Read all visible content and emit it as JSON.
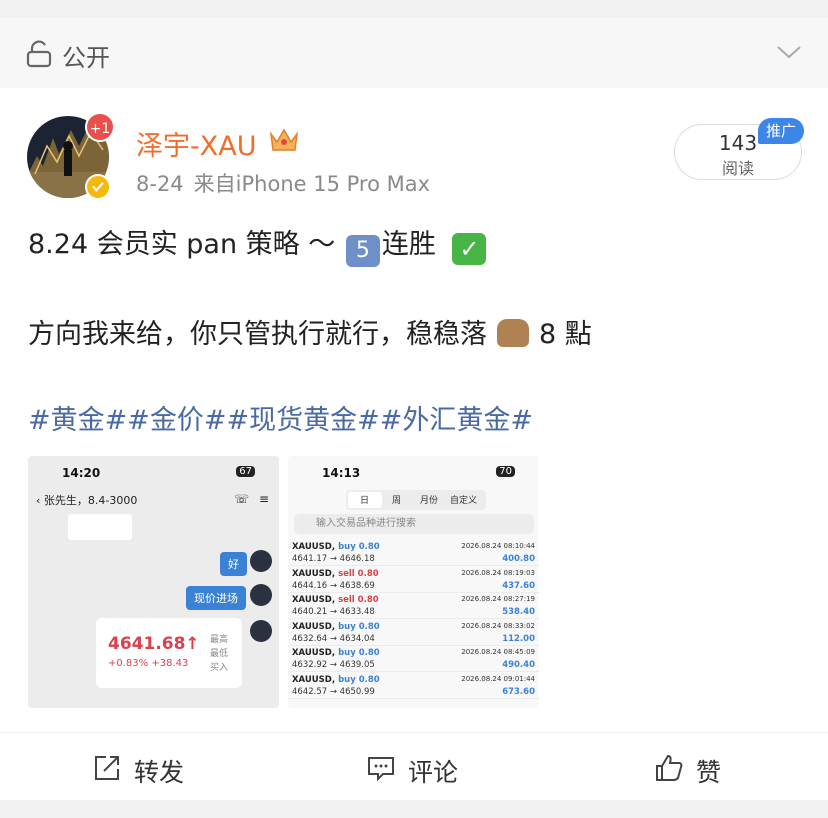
{
  "visibility": {
    "label": "公开"
  },
  "post": {
    "author": "泽宇-XAU",
    "notification_badge": "+1",
    "date": "8-24",
    "source": "来自iPhone 15 Pro Max",
    "reads": {
      "count": "143",
      "label": "阅读"
    },
    "promo_tag": "推广",
    "line1_text": "8.24 会员实 pan 策略 ～",
    "line1_emoji_number": "5",
    "line1_after": "连胜",
    "line2_text": "方向我来给，你只管执行就行，稳稳落",
    "line2_after": "8 點",
    "hashtags": "#黄金##金价##现货黄金##外汇黄金#"
  },
  "thumb_left": {
    "time": "14:20",
    "battery": "67",
    "chat_title": "张先生，8.4-3000",
    "messages": [
      "好",
      "现价进场"
    ],
    "quote": {
      "price": "4641.68↑",
      "change": "+0.83%  +38.43",
      "labels": [
        "最高",
        "最低",
        "买入"
      ]
    }
  },
  "thumb_right": {
    "time": "14:13",
    "battery": "70",
    "tabs": [
      "日",
      "周",
      "月份",
      "自定义"
    ],
    "search_placeholder": "输入交易品种进行搜索",
    "trades": [
      {
        "symbol": "XAUUSD,",
        "side": "buy 0.80",
        "date": "2026.08.24 08:10:44",
        "prices": "4641.17 → 4646.18",
        "profit": "400.80"
      },
      {
        "symbol": "XAUUSD,",
        "side": "sell 0.80",
        "date": "2026.08.24 08:19:03",
        "prices": "4644.16 → 4638.69",
        "profit": "437.60"
      },
      {
        "symbol": "XAUUSD,",
        "side": "sell 0.80",
        "date": "2026.08.24 08:27:19",
        "prices": "4640.21 → 4633.48",
        "profit": "538.40"
      },
      {
        "symbol": "XAUUSD,",
        "side": "buy 0.80",
        "date": "2026.08.24 08:33:02",
        "prices": "4632.64 → 4634.04",
        "profit": "112.00"
      },
      {
        "symbol": "XAUUSD,",
        "side": "buy 0.80",
        "date": "2026.08.24 08:45:09",
        "prices": "4632.92 → 4639.05",
        "profit": "490.40"
      },
      {
        "symbol": "XAUUSD,",
        "side": "buy 0.80",
        "date": "2026.08.24 09:01:44",
        "prices": "4642.57 → 4650.99",
        "profit": "673.60"
      }
    ]
  },
  "actions": {
    "repost": "转发",
    "comment": "评论",
    "like": "赞"
  }
}
